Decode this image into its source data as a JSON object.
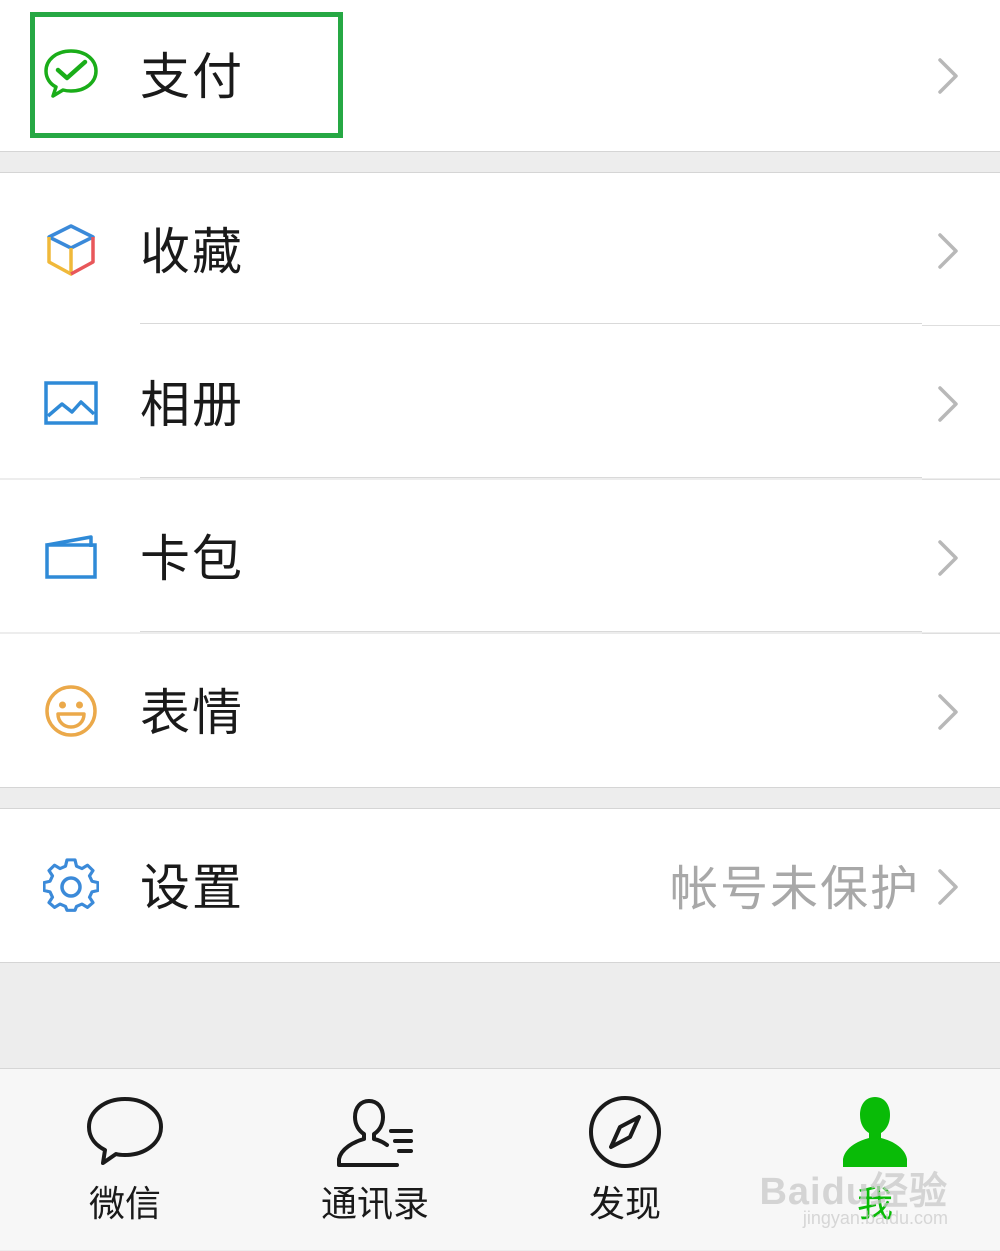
{
  "menu": {
    "pay": {
      "label": "支付",
      "icon": "wechat-pay-icon"
    },
    "favorites": {
      "label": "收藏",
      "icon": "favorites-cube-icon"
    },
    "album": {
      "label": "相册",
      "icon": "album-picture-icon"
    },
    "cards": {
      "label": "卡包",
      "icon": "card-wallet-icon"
    },
    "stickers": {
      "label": "表情",
      "icon": "smiley-face-icon"
    },
    "settings": {
      "label": "设置",
      "value": "帐号未保护",
      "icon": "gear-icon"
    }
  },
  "tabbar": {
    "tabs": [
      {
        "label": "微信",
        "icon": "chat-bubble-icon",
        "active": false
      },
      {
        "label": "通讯录",
        "icon": "contacts-icon",
        "active": false
      },
      {
        "label": "发现",
        "icon": "compass-icon",
        "active": false
      },
      {
        "label": "我",
        "icon": "me-person-icon",
        "active": true
      }
    ]
  },
  "watermark": {
    "text": "Baidu经验",
    "sub": "jingyan.baidu.com"
  },
  "colors": {
    "highlight_box": "#26a844",
    "active_tab": "#09bb07",
    "pay_icon": "#1aad19",
    "settings_icon": "#3b8ad9",
    "sticker_icon": "#eba94a",
    "album_icon": "#2f8ad7",
    "card_icon": "#2f8ad7"
  }
}
